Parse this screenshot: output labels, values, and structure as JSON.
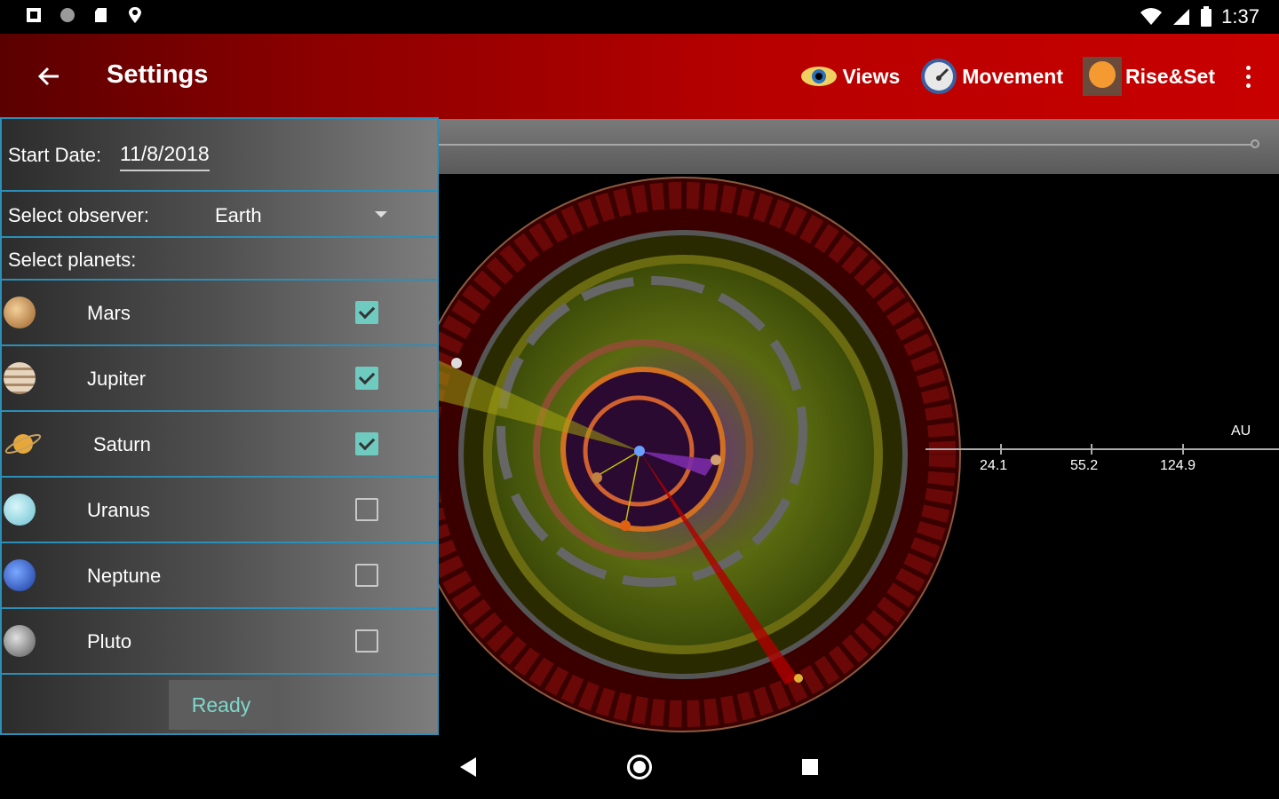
{
  "status_bar": {
    "time": "1:37"
  },
  "app_bar": {
    "title": "Settings",
    "actions": [
      {
        "label": "Views",
        "icon": "eye-icon"
      },
      {
        "label": "Movement",
        "icon": "speedometer-icon"
      },
      {
        "label": "Rise&Set",
        "icon": "sun-icon"
      }
    ]
  },
  "settings": {
    "start_date_label": "Start Date:",
    "start_date_value": "11/8/2018",
    "observer_label": "Select observer:",
    "observer_value": "Earth",
    "planets_label": "Select planets:",
    "planets": [
      {
        "name": "Mars",
        "checked": true,
        "color": "#d9a066"
      },
      {
        "name": "Jupiter",
        "checked": true,
        "color": "#c9b49a"
      },
      {
        "name": "Saturn",
        "checked": true,
        "color": "#e0a030"
      },
      {
        "name": "Uranus",
        "checked": false,
        "color": "#a8e4ee"
      },
      {
        "name": "Neptune",
        "checked": false,
        "color": "#3a6fe0"
      },
      {
        "name": "Pluto",
        "checked": false,
        "color": "#9a9a9a"
      }
    ],
    "ready_label": "Ready"
  },
  "chart": {
    "axis_unit": "AU",
    "ticks": [
      "24.1",
      "55.2",
      "124.9"
    ]
  },
  "colors": {
    "accent": "#2b8fb8",
    "appbar": "#b80000",
    "check": "#6fcac0"
  }
}
